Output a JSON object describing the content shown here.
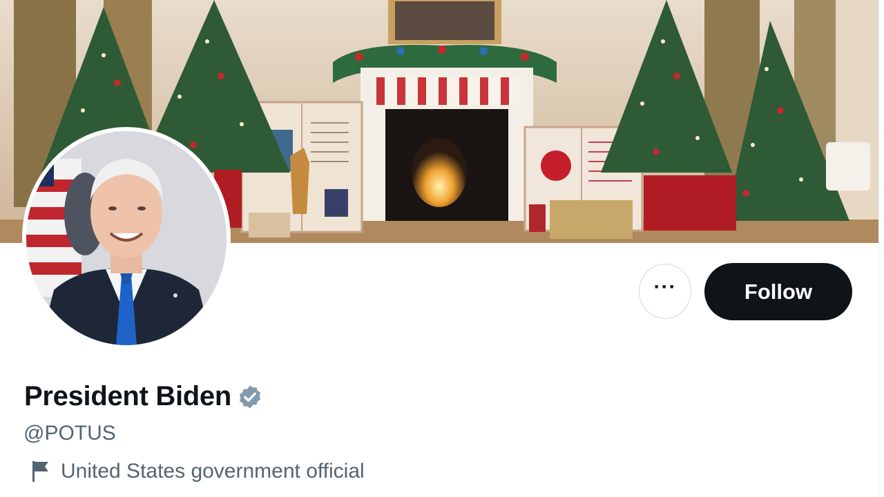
{
  "profile": {
    "display_name": "President Biden",
    "handle": "@POTUS",
    "affiliation_label": "United States government official",
    "verified": true
  },
  "actions": {
    "more_label": "···",
    "follow_label": "Follow"
  },
  "icons": {
    "verified": "verified-badge-icon",
    "more": "more-icon",
    "affiliation": "flag-icon"
  },
  "colors": {
    "follow_bg": "#0f1419",
    "secondary_text": "#536471",
    "verified_badge": "#829aab"
  }
}
